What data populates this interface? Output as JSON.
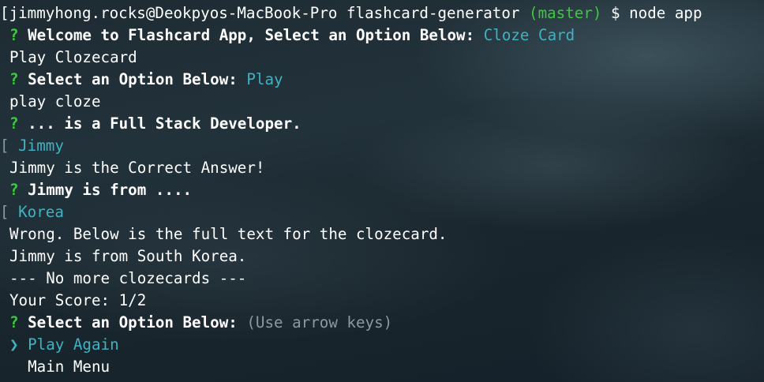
{
  "colors": {
    "question_mark": "#3dc93d",
    "branch": "#3dc93d",
    "answer": "#3fb3c2",
    "hint": "#8a9aa3",
    "text": "#ffffff"
  },
  "prompt": {
    "bracket": "[",
    "user_host_dir": "jimmyhong.rocks@Deokpyos-MacBook-Pro flashcard-generator ",
    "branch": "(master)",
    "dollar": " $ ",
    "command": "node app"
  },
  "q1": {
    "mark": "?",
    "text": " Welcome to Flashcard App, Select an Option Below: ",
    "answer": "Cloze Card"
  },
  "out1": "Play Clozecard",
  "q2": {
    "mark": "?",
    "text": " Select an Option Below: ",
    "answer": "Play"
  },
  "out2": "play cloze",
  "q3": {
    "mark": "?",
    "text": " ... is a Full Stack Developer."
  },
  "in1": {
    "bracket": "[",
    "answer": " Jimmy"
  },
  "out3": "Jimmy is the Correct Answer!",
  "q4": {
    "mark": "?",
    "text": " Jimmy is from ...."
  },
  "in2": {
    "bracket": "[",
    "answer": " Korea"
  },
  "out4": "Wrong. Below is the full text for the clozecard.",
  "out5": "Jimmy is from South Korea.",
  "out6": "--- No more clozecards ---",
  "out7": "Your Score: 1/2",
  "q5": {
    "mark": "?",
    "text": " Select an Option Below: ",
    "hint": "(Use arrow keys)"
  },
  "menu": {
    "selected_pointer": "❯",
    "selected_label": " Play Again",
    "other_label": "  Main Menu"
  }
}
